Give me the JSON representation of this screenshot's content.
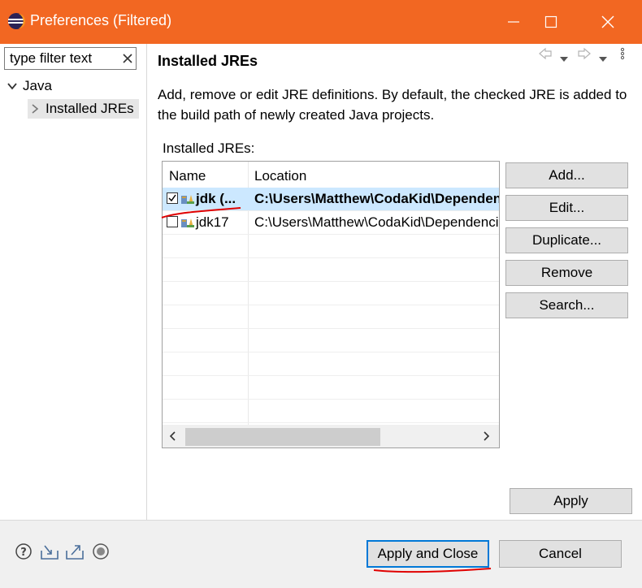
{
  "window": {
    "title": "Preferences (Filtered)",
    "title_bar_color": "#f26722",
    "buttons": [
      "minimize-icon",
      "maximize-icon",
      "close-icon"
    ]
  },
  "sidebar": {
    "filter": {
      "value": "type filter text",
      "clear_icon": "clear-icon"
    },
    "tree": [
      {
        "label": "Java",
        "expanded": true
      },
      {
        "label": "Installed JREs",
        "selected": true
      }
    ]
  },
  "page": {
    "title": "Installed JREs",
    "description": "Add, remove or edit JRE definitions. By default, the checked JRE is added to the build path of newly created Java projects.",
    "table_label": "Installed JREs:",
    "nav_icons": [
      "back-icon",
      "dropdown-icon",
      "forward-icon",
      "dropdown-icon",
      "menu-icon"
    ]
  },
  "table": {
    "columns": [
      "Name",
      "Location"
    ],
    "rows": [
      {
        "name": "jdk (...",
        "location": "C:\\Users\\Matthew\\CodaKid\\Dependencies",
        "checked": true,
        "selected": true
      },
      {
        "name": "jdk17",
        "location": "C:\\Users\\Matthew\\CodaKid\\Dependencies",
        "checked": false,
        "selected": false
      }
    ]
  },
  "side_buttons": {
    "add": "Add...",
    "edit": "Edit...",
    "duplicate": "Duplicate...",
    "remove": "Remove",
    "search": "Search..."
  },
  "footer": {
    "apply": "Apply",
    "apply_and_close": "Apply and Close",
    "cancel": "Cancel",
    "icons": [
      "help-icon",
      "import-icon",
      "export-icon",
      "oomph-icon"
    ]
  },
  "colors": {
    "accent": "#0078d7",
    "selection": "#cce8ff",
    "annotation": "#e00000"
  }
}
